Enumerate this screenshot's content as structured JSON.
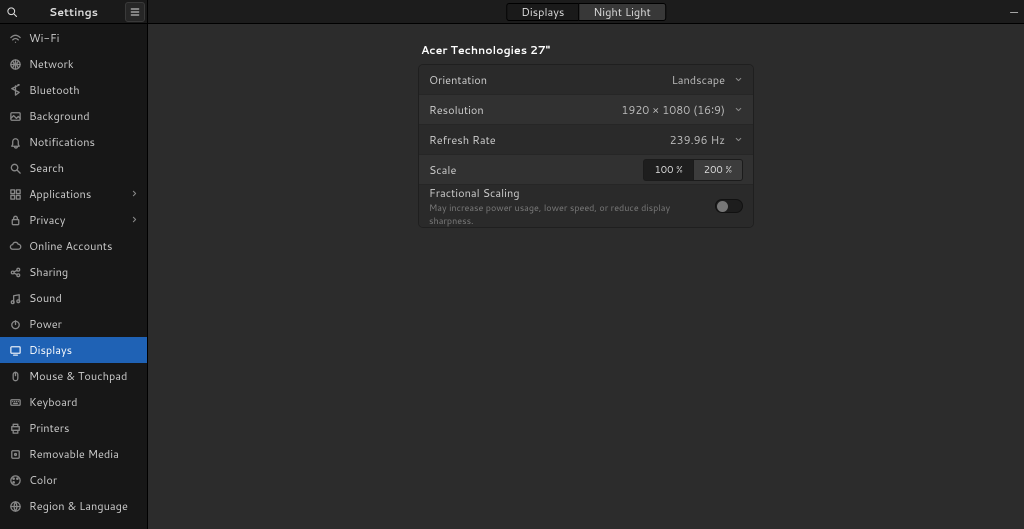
{
  "header": {
    "title": "Settings"
  },
  "sidebar": [
    {
      "icon": "wifi",
      "label": "Wi-Fi"
    },
    {
      "icon": "globe",
      "label": "Network"
    },
    {
      "icon": "bt",
      "label": "Bluetooth"
    },
    {
      "icon": "bg",
      "label": "Background"
    },
    {
      "icon": "bell",
      "label": "Notifications"
    },
    {
      "icon": "search",
      "label": "Search"
    },
    {
      "icon": "grid",
      "label": "Applications",
      "chev": true
    },
    {
      "icon": "lock",
      "label": "Privacy",
      "chev": true
    },
    {
      "icon": "cloud",
      "label": "Online Accounts"
    },
    {
      "icon": "share",
      "label": "Sharing"
    },
    {
      "icon": "note",
      "label": "Sound"
    },
    {
      "icon": "power",
      "label": "Power"
    },
    {
      "icon": "display",
      "label": "Displays",
      "active": true
    },
    {
      "icon": "mouse",
      "label": "Mouse & Touchpad"
    },
    {
      "icon": "kbd",
      "label": "Keyboard"
    },
    {
      "icon": "printer",
      "label": "Printers"
    },
    {
      "icon": "media",
      "label": "Removable Media"
    },
    {
      "icon": "color",
      "label": "Color"
    },
    {
      "icon": "region",
      "label": "Region & Language"
    }
  ],
  "tabs": {
    "displays": "Displays",
    "nightlight": "Night Light"
  },
  "panel": {
    "title": "Acer Technologies 27\"",
    "orientation_label": "Orientation",
    "orientation_value": "Landscape",
    "resolution_label": "Resolution",
    "resolution_value": "1920 × 1080 (16∶9)",
    "refresh_label": "Refresh Rate",
    "refresh_value": "239.96 Hz",
    "scale_label": "Scale",
    "scale_options": [
      "100 %",
      "200 %"
    ],
    "fractional_label": "Fractional Scaling",
    "fractional_desc": "May increase power usage, lower speed, or reduce display sharpness."
  }
}
